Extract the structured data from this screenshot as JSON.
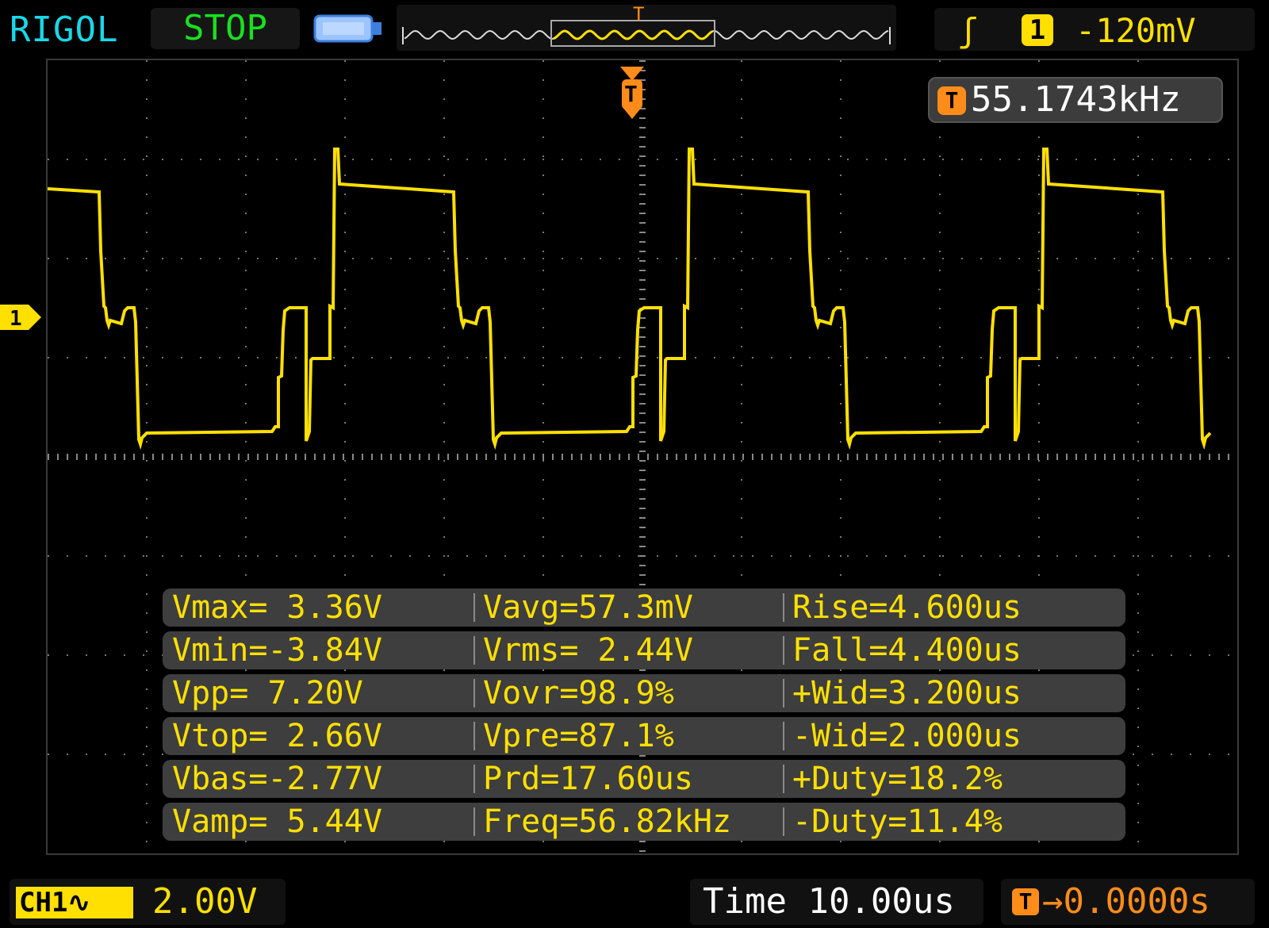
{
  "header": {
    "brand": "RIGOL",
    "run_status": "STOP",
    "trigger": {
      "edge_symbol": "ʃ",
      "source": "1",
      "level": "-120mV"
    }
  },
  "screen": {
    "trigger_marker": "T",
    "trigger_frequency": {
      "badge": "T",
      "value": "55.1743kHz"
    },
    "channel_marker": "1",
    "trace_color": "#ffe000"
  },
  "measurements": [
    [
      "Vmax= 3.36V",
      "Vavg=57.3mV",
      "Rise=4.600us"
    ],
    [
      "Vmin=-3.84V",
      "Vrms= 2.44V",
      "Fall=4.400us"
    ],
    [
      "Vpp= 7.20V",
      "Vovr=98.9%",
      "+Wid=3.200us"
    ],
    [
      "Vtop= 2.66V",
      "Vpre=87.1%",
      "-Wid=2.000us"
    ],
    [
      "Vbas=-2.77V",
      "Prd=17.60us",
      "+Duty=18.2%"
    ],
    [
      "Vamp= 5.44V",
      "Freq=56.82kHz",
      "-Duty=11.4%"
    ]
  ],
  "footer": {
    "channel": {
      "label": "CH1∿",
      "scale": "2.00V"
    },
    "timebase": "Time 10.00us",
    "trigger_offset": {
      "badge": "T",
      "value": "→0.0000s"
    }
  }
}
